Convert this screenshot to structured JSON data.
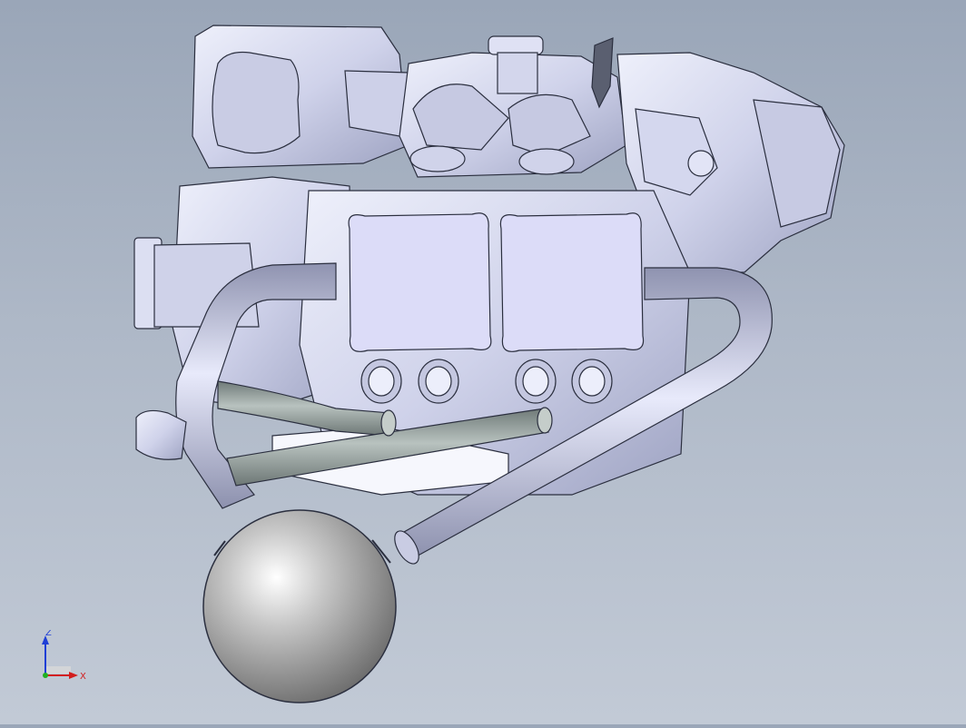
{
  "viewport": {
    "background_top": "#9aa6b8",
    "background_bottom": "#c2cad6",
    "model_fill": "#d8dbef",
    "model_edge": "#2b2f3f",
    "hose_fill": "#a9b3b0",
    "tank_fill": "#b4b4b4"
  },
  "triad": {
    "z_label": "Z",
    "x_label": "X",
    "z_color": "#1f3fd6",
    "x_color": "#d21e1e",
    "origin_color": "#20b020"
  },
  "icons": [
    "coordinate-triad-icon"
  ]
}
